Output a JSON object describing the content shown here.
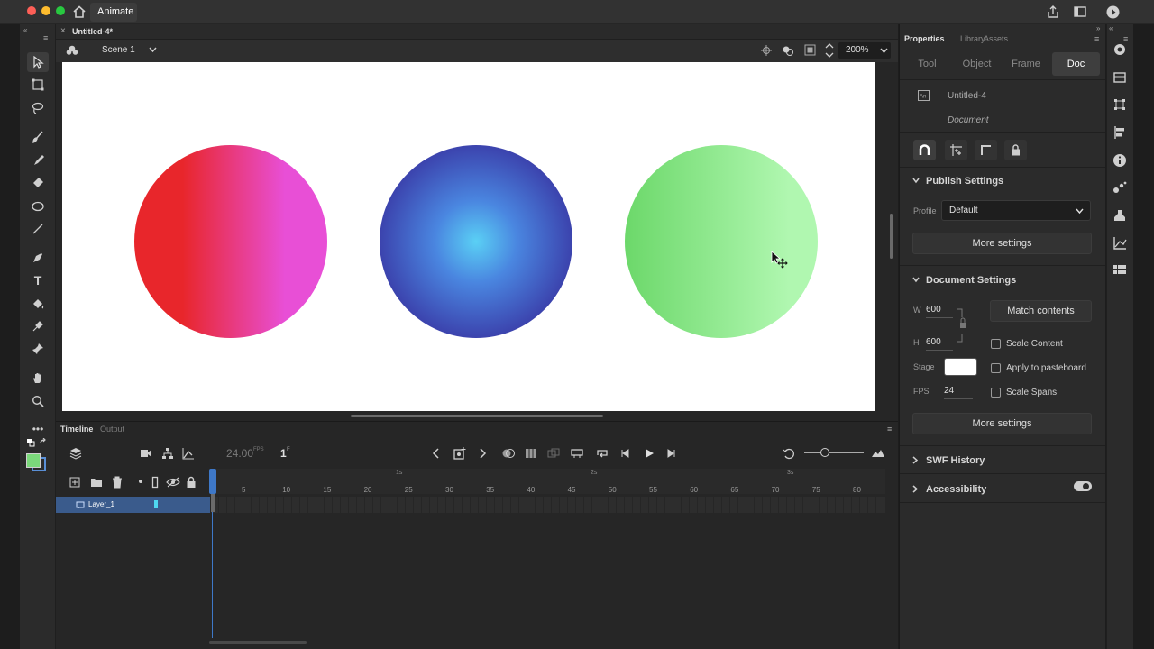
{
  "app": {
    "name": "Animate"
  },
  "document": {
    "tab_title": "Untitled-4*",
    "scene": "Scene 1",
    "zoom": "200%"
  },
  "panel_tabs": {
    "properties": "Properties",
    "library": "Library",
    "assets": "Assets"
  },
  "prop_tabs": [
    "Tool",
    "Object",
    "Frame",
    "Doc"
  ],
  "doc_info": {
    "name": "Untitled-4",
    "type": "Document"
  },
  "publish": {
    "title": "Publish Settings",
    "profile_label": "Profile",
    "profile_value": "Default",
    "more": "More settings"
  },
  "docset": {
    "title": "Document Settings",
    "w_label": "W",
    "w_value": "600",
    "h_label": "H",
    "h_value": "600",
    "match": "Match contents",
    "stage_label": "Stage",
    "stage_color": "#ffffff",
    "fps_label": "FPS",
    "fps_value": "24",
    "scale_content": "Scale Content",
    "apply_pasteboard": "Apply to pasteboard",
    "scale_spans": "Scale Spans",
    "more": "More settings"
  },
  "swf": {
    "title": "SWF History"
  },
  "access": {
    "title": "Accessibility"
  },
  "timeline": {
    "tab_timeline": "Timeline",
    "tab_output": "Output",
    "fps": "24.00",
    "fps_unit": "FPS",
    "frame": "1",
    "frame_unit": "F",
    "layer_name": "Layer_1",
    "ruler_numbers": [
      "5",
      "10",
      "15",
      "20",
      "25",
      "30",
      "35",
      "40",
      "45",
      "50",
      "55",
      "60",
      "65",
      "70",
      "75",
      "80"
    ],
    "time_marks": [
      "1s",
      "2s",
      "3s"
    ]
  },
  "colors": {
    "fill": "#7bd97b",
    "accent": "#2d8cf0",
    "circle1_left": "#e8262b",
    "circle1_right": "#e84fd6",
    "circle2_center": "#5ad0f5",
    "circle2_edge": "#3a3ca8",
    "circle3_left": "#6cd86a",
    "circle3_right": "#b0f7b0"
  }
}
